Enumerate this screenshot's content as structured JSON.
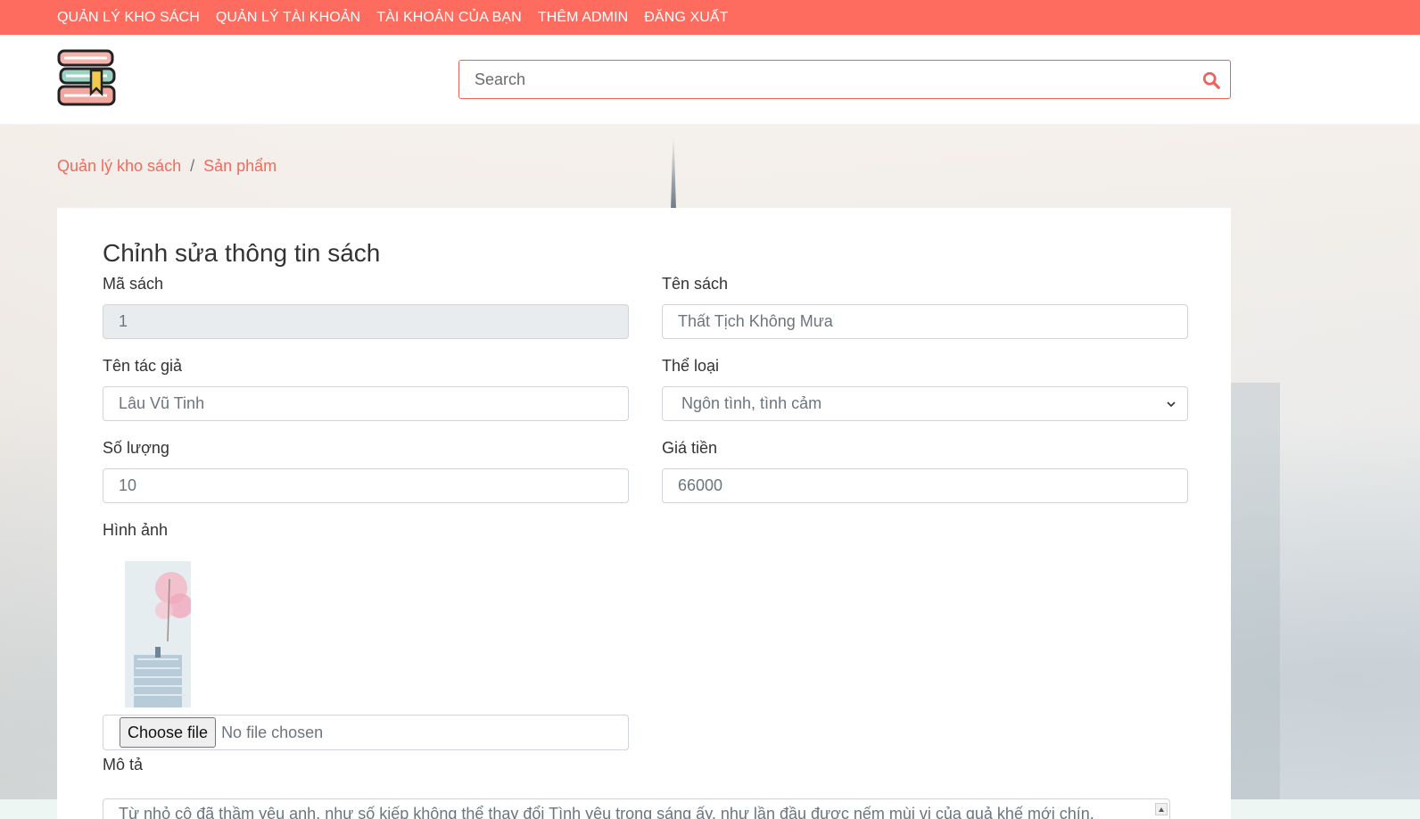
{
  "nav": {
    "items": [
      {
        "label": "QUẢN LÝ KHO SÁCH"
      },
      {
        "label": "QUẢN LÝ TÀI KHOẢN"
      },
      {
        "label": "TÀI KHOẢN CỦA BẠN"
      },
      {
        "label": "THÊM ADMIN"
      },
      {
        "label": "ĐĂNG XUẤT"
      }
    ],
    "color": "#fe6c5f"
  },
  "header": {
    "logo_icon": "books-stack-logo",
    "search": {
      "placeholder": "Search",
      "value": "",
      "icon": "search-icon"
    }
  },
  "breadcrumb": {
    "items": [
      {
        "label": "Quản lý kho sách"
      },
      {
        "label": "Sản phẩm"
      }
    ],
    "separator": "/"
  },
  "form": {
    "title": "Chỉnh sửa thông tin sách",
    "book_id": {
      "label": "Mã sách",
      "value": "1"
    },
    "book_name": {
      "label": "Tên sách",
      "value": "Thất Tịch Không Mưa"
    },
    "author": {
      "label": "Tên tác giả",
      "value": "Lâu Vũ Tinh"
    },
    "category": {
      "label": "Thể loại",
      "value": "Ngôn tình, tình cảm"
    },
    "quantity": {
      "label": "Số lượng",
      "value": "10"
    },
    "price": {
      "label": "Giá tiền",
      "value": "66000"
    },
    "image": {
      "label": "Hình ảnh",
      "button_label": "Choose file",
      "status": "No file chosen"
    },
    "description": {
      "label": "Mô tả",
      "value": "Từ nhỏ cô đã thầm yêu anh, như số kiếp không thể thay đổi Tình yêu trong sáng ấy, như lần đầu được nếm mùi vị của quả khế mới chín."
    }
  },
  "colors": {
    "accent": "#f06b5f",
    "topbar": "#fe6c5f"
  }
}
